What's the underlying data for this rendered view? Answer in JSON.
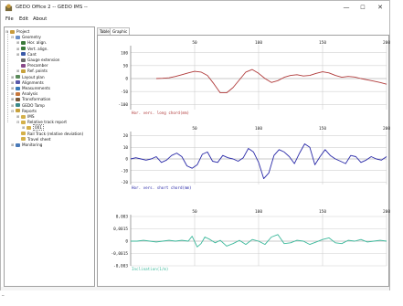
{
  "window": {
    "title": "GEDO Office 2 -- GEDO IMS --",
    "minimize_glyph": "—",
    "maximize_glyph": "☐",
    "close_glyph": "✕",
    "app_icon": "gedo-app-icon"
  },
  "menu": [
    "File",
    "Edit",
    "About"
  ],
  "tree": [
    {
      "label": "Project",
      "depth": 0,
      "icon": "folder",
      "color": "#c89b3c",
      "expander": "⊟"
    },
    {
      "label": "Geometry",
      "depth": 1,
      "icon": "geometry",
      "color": "#6a8ec8",
      "expander": "⊟"
    },
    {
      "label": "Hor. align.",
      "depth": 2,
      "icon": "pencil",
      "color": "#3a7a3a",
      "expander": "⊞"
    },
    {
      "label": "Vert. align.",
      "depth": 2,
      "icon": "pencil",
      "color": "#3a7a3a",
      "expander": "⊞"
    },
    {
      "label": "Cant",
      "depth": 2,
      "icon": "cant",
      "color": "#3a5aa8",
      "expander": "⊞"
    },
    {
      "label": "Gauge extension",
      "depth": 2,
      "icon": "gauge",
      "color": "#6a6a6a",
      "expander": ""
    },
    {
      "label": "Precamber",
      "depth": 2,
      "icon": "precamber",
      "color": "#8a4a8a",
      "expander": ""
    },
    {
      "label": "Ref. points",
      "depth": 2,
      "icon": "points",
      "color": "#c8a23c",
      "expander": "⊞"
    },
    {
      "label": "Layout plan",
      "depth": 1,
      "icon": "layout",
      "color": "#5a8a5a",
      "expander": "⊞"
    },
    {
      "label": "Alignments",
      "depth": 1,
      "icon": "alignments",
      "color": "#5a5aaa",
      "expander": "⊞"
    },
    {
      "label": "Measurements",
      "depth": 1,
      "icon": "measurements",
      "color": "#3a7ab8",
      "expander": "⊞"
    },
    {
      "label": "Analysis",
      "depth": 1,
      "icon": "analysis",
      "color": "#c8783c",
      "expander": "⊞"
    },
    {
      "label": "Transformation",
      "depth": 1,
      "icon": "transformation",
      "color": "#7a5a3a",
      "expander": "⊞"
    },
    {
      "label": "GEDO Tamp",
      "depth": 1,
      "icon": "tamp",
      "color": "#3a8a8a",
      "expander": "⊞"
    },
    {
      "label": "Reports",
      "depth": 1,
      "icon": "reports",
      "color": "#c8a23c",
      "expander": "⊟"
    },
    {
      "label": "IMS",
      "depth": 2,
      "icon": "report",
      "color": "#d4b04a",
      "expander": "⊞"
    },
    {
      "label": "Relative track report",
      "depth": 2,
      "icon": "report",
      "color": "#d4b04a",
      "expander": "⊟"
    },
    {
      "label": "001",
      "depth": 3,
      "icon": "report-item",
      "color": "#d4b04a",
      "expander": "⊞",
      "selected": true
    },
    {
      "label": "Rail Track (relative deviation)",
      "depth": 2,
      "icon": "report",
      "color": "#d4b04a",
      "expander": ""
    },
    {
      "label": "Travel sheet",
      "depth": 2,
      "icon": "report",
      "color": "#d4b04a",
      "expander": ""
    },
    {
      "label": "Monitoring",
      "depth": 1,
      "icon": "monitoring",
      "color": "#4a7ab8",
      "expander": "⊞"
    }
  ],
  "tabs": [
    {
      "label": "Table",
      "active": false
    },
    {
      "label": "Graphic",
      "active": true
    }
  ],
  "status": {
    "mark_a": "_",
    "mark_b": "-"
  },
  "chart_data": [
    {
      "type": "line",
      "title": "Hor. vers. long chord(mm)",
      "xlim": [
        0,
        200
      ],
      "x_ticks": [
        "50",
        "100",
        "150",
        "200"
      ],
      "ylim": [
        -120,
        120
      ],
      "y_ticks": [
        "100",
        "50",
        "0",
        "-50",
        "-100"
      ],
      "y_tick_values": [
        100,
        50,
        0,
        -50,
        -100
      ],
      "grid": true,
      "series": [
        {
          "color": "#b03a3a",
          "x": [
            20,
            25,
            30,
            35,
            40,
            45,
            50,
            55,
            60,
            65,
            70,
            75,
            80,
            85,
            90,
            95,
            100,
            105,
            110,
            115,
            120,
            125,
            130,
            135,
            140,
            145,
            150,
            155,
            160,
            165,
            170,
            175,
            180,
            185,
            190,
            195,
            200
          ],
          "y": [
            0,
            1,
            3,
            8,
            15,
            22,
            28,
            25,
            12,
            -20,
            -55,
            -55,
            -35,
            -5,
            25,
            35,
            20,
            0,
            -15,
            -8,
            5,
            12,
            15,
            10,
            12,
            20,
            26,
            22,
            12,
            5,
            8,
            6,
            0,
            -5,
            -10,
            -15,
            -22
          ]
        }
      ]
    },
    {
      "type": "line",
      "title": "Hor. vers. short chord(mm)",
      "xlim": [
        0,
        200
      ],
      "x_ticks": [
        "50",
        "100",
        "150",
        "200"
      ],
      "ylim": [
        -22,
        22
      ],
      "y_ticks": [
        "20",
        "10",
        "0",
        "-10",
        "-20"
      ],
      "y_tick_values": [
        20,
        10,
        0,
        -10,
        -20
      ],
      "grid": true,
      "series": [
        {
          "color": "#2a2aa8",
          "x": [
            0,
            4,
            8,
            12,
            16,
            20,
            24,
            28,
            32,
            36,
            40,
            44,
            48,
            52,
            56,
            60,
            64,
            68,
            72,
            76,
            80,
            84,
            88,
            92,
            96,
            100,
            104,
            108,
            112,
            116,
            120,
            124,
            128,
            132,
            136,
            140,
            144,
            148,
            152,
            156,
            160,
            164,
            168,
            172,
            176,
            180,
            184,
            188,
            192,
            196,
            200
          ],
          "y": [
            0,
            1,
            0,
            -1,
            0,
            2,
            -3,
            -1,
            3,
            5,
            2,
            -6,
            -8,
            -5,
            4,
            6,
            -2,
            -3,
            3,
            1,
            0,
            -2,
            1,
            9,
            6,
            -3,
            -17,
            -12,
            3,
            8,
            6,
            2,
            -4,
            5,
            13,
            10,
            -5,
            2,
            8,
            3,
            0,
            -2,
            -4,
            3,
            2,
            -3,
            -1,
            2,
            0,
            -1,
            2
          ]
        }
      ]
    },
    {
      "type": "line",
      "title": "Inclination(1/m)",
      "xlim": [
        0,
        200
      ],
      "x_ticks": [
        "50",
        "100",
        "150",
        "200"
      ],
      "ylim": [
        -0.003,
        0.003
      ],
      "y_ticks": [
        "0,003",
        "0,0015",
        "0",
        "-0,0015",
        "-0,003"
      ],
      "y_tick_values": [
        0.003,
        0.0015,
        0,
        -0.0015,
        -0.003
      ],
      "grid": true,
      "series": [
        {
          "color": "#3ab89a",
          "x": [
            0,
            5,
            10,
            15,
            20,
            25,
            30,
            35,
            40,
            45,
            48,
            52,
            55,
            58,
            62,
            66,
            70,
            75,
            80,
            85,
            90,
            95,
            100,
            105,
            110,
            115,
            120,
            125,
            130,
            135,
            140,
            145,
            150,
            155,
            160,
            165,
            170,
            175,
            180,
            185,
            190,
            195,
            200
          ],
          "y": [
            0,
            0,
            0.0001,
            0,
            -0.0001,
            0,
            0.0001,
            0,
            0.0001,
            0,
            0.0006,
            -0.0007,
            -0.0003,
            0.0005,
            0.0002,
            -0.0002,
            0.0001,
            -0.0006,
            -0.0003,
            0.0001,
            -0.0004,
            0.0002,
            0,
            -0.0004,
            0.0005,
            0.0008,
            -0.0003,
            -0.0002,
            0.0001,
            0,
            -0.0004,
            -0.0001,
            0.0002,
            0.0004,
            -0.0002,
            -0.0003,
            0.0001,
            0,
            0.0002,
            -0.0001,
            0,
            0.0001,
            0
          ]
        }
      ]
    }
  ]
}
